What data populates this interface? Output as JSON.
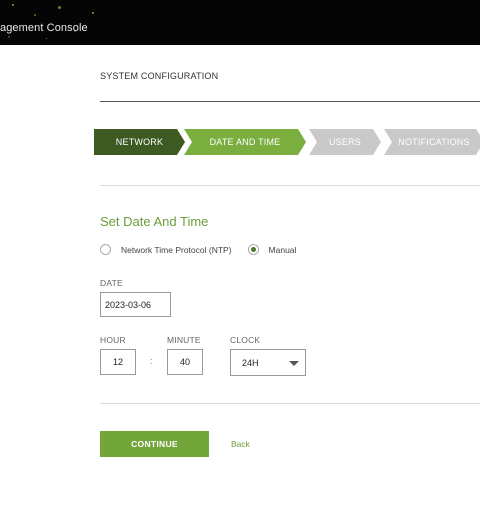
{
  "header": {
    "app_title": "agement Console"
  },
  "page": {
    "title": "SYSTEM CONFIGURATION"
  },
  "steps": [
    {
      "label": "NETWORK",
      "state": "done"
    },
    {
      "label": "DATE AND TIME",
      "state": "active"
    },
    {
      "label": "USERS",
      "state": "todo"
    },
    {
      "label": "NOTIFICATIONS",
      "state": "todo"
    }
  ],
  "section": {
    "title": "Set Date And Time",
    "options": [
      {
        "label": "Network Time Protocol (NTP)",
        "selected": false
      },
      {
        "label": "Manual",
        "selected": true
      }
    ]
  },
  "date": {
    "label": "DATE",
    "value": "2023-03-06"
  },
  "time": {
    "hour_label": "HOUR",
    "hour_value": "12",
    "separator": ":",
    "minute_label": "MINUTE",
    "minute_value": "40",
    "clock_label": "CLOCK",
    "clock_value": "24H"
  },
  "actions": {
    "continue_label": "CONTINUE",
    "back_label": "Back"
  },
  "colors": {
    "accent": "#72a63a",
    "step_done": "#3d5a22",
    "step_active": "#7aae3f",
    "step_todo": "#c9c9c9",
    "topbar": "#050505"
  }
}
